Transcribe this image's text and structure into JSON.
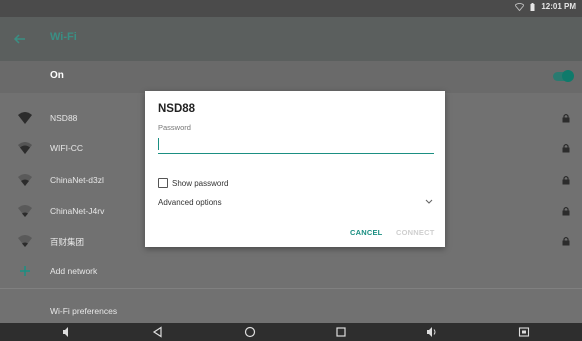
{
  "status_bar": {
    "time": "12:01 PM"
  },
  "app_bar": {
    "title": "Wi-Fi"
  },
  "master_switch": {
    "label": "On",
    "enabled": true
  },
  "networks": [
    {
      "name": "NSD88",
      "locked": true
    },
    {
      "name": "WIFI-CC",
      "locked": true
    },
    {
      "name": "ChinaNet-d3zl",
      "locked": true
    },
    {
      "name": "ChinaNet-J4rv",
      "locked": true
    },
    {
      "name": "百财集团",
      "locked": true
    }
  ],
  "add_network": {
    "label": "Add network"
  },
  "preferences": {
    "label": "Wi-Fi preferences"
  },
  "dialog": {
    "title": "NSD88",
    "password_label": "Password",
    "password_value": "",
    "show_password_label": "Show password",
    "advanced_label": "Advanced options",
    "cancel_label": "CANCEL",
    "connect_label": "CONNECT"
  },
  "colors": {
    "accent": "#1b8f82",
    "title_teal": "#3a8f84"
  }
}
